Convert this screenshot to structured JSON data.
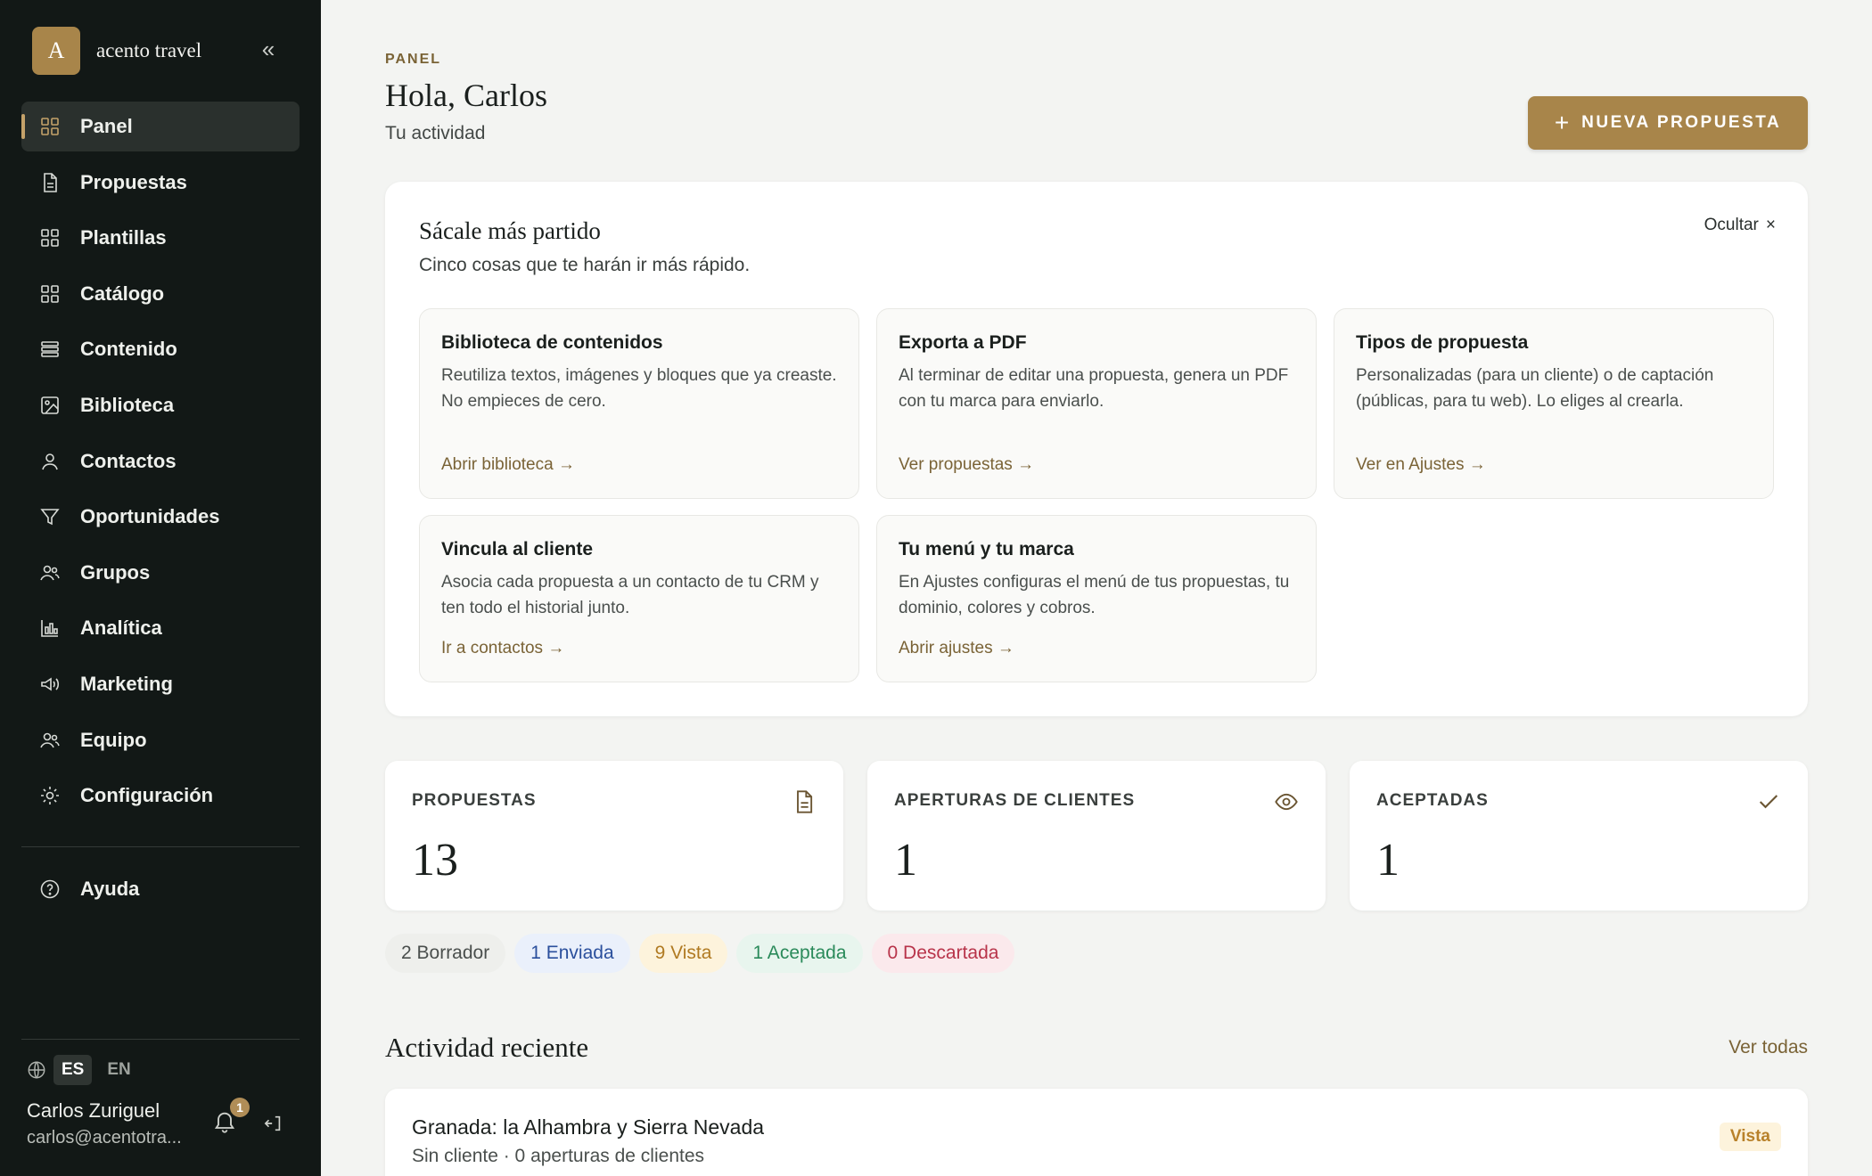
{
  "brand": {
    "initial": "A",
    "name": "acento travel",
    "collapse_icon": "double-chevron-left"
  },
  "nav": [
    {
      "label": "Panel",
      "icon": "dashboard-grid",
      "active": true
    },
    {
      "label": "Propuestas",
      "icon": "document"
    },
    {
      "label": "Plantillas",
      "icon": "grid"
    },
    {
      "label": "Catálogo",
      "icon": "grid"
    },
    {
      "label": "Contenido",
      "icon": "stack"
    },
    {
      "label": "Biblioteca",
      "icon": "image"
    },
    {
      "label": "Contactos",
      "icon": "user"
    },
    {
      "label": "Oportunidades",
      "icon": "filter"
    },
    {
      "label": "Grupos",
      "icon": "users"
    },
    {
      "label": "Analítica",
      "icon": "bar-chart"
    },
    {
      "label": "Marketing",
      "icon": "megaphone"
    },
    {
      "label": "Equipo",
      "icon": "users"
    },
    {
      "label": "Configuración",
      "icon": "sun-gear"
    }
  ],
  "help": {
    "label": "Ayuda",
    "icon": "question-circle"
  },
  "language": {
    "current": "ES",
    "other": "EN"
  },
  "user": {
    "name": "Carlos Zuriguel",
    "email": "carlos@acentotra...",
    "notifications": "1"
  },
  "header": {
    "eyebrow": "PANEL",
    "greeting": "Hola, Carlos",
    "subtitle": "Tu actividad",
    "new_button": "NUEVA PROPUESTA",
    "new_button_icon": "+"
  },
  "tips": {
    "title": "Sácale más partido",
    "subtitle": "Cinco cosas que te harán ir más rápido.",
    "hide_label": "Ocultar",
    "hide_icon": "×",
    "cards": [
      {
        "title": "Biblioteca de contenidos",
        "text": "Reutiliza textos, imágenes y bloques que ya creaste. No empieces de cero.",
        "link": "Abrir biblioteca →"
      },
      {
        "title": "Exporta a PDF",
        "text": "Al terminar de editar una propuesta, genera un PDF con tu marca para enviarlo.",
        "link": "Ver propuestas →"
      },
      {
        "title": "Tipos de propuesta",
        "text": "Personalizadas (para un cliente) o de captación (públicas, para tu web). Lo eliges al crearla.",
        "link": "Ver en Ajustes →"
      },
      {
        "title": "Vincula al cliente",
        "text": "Asocia cada propuesta a un contacto de tu CRM y ten todo el historial junto.",
        "link": "Ir a contactos →"
      },
      {
        "title": "Tu menú y tu marca",
        "text": "En Ajustes configuras el menú de tus propuestas, tu dominio, colores y cobros.",
        "link": "Abrir ajustes →"
      }
    ]
  },
  "stats": [
    {
      "label": "PROPUESTAS",
      "value": "13",
      "icon": "document-icon"
    },
    {
      "label": "APERTURAS DE CLIENTES",
      "value": "1",
      "icon": "eye-icon"
    },
    {
      "label": "ACEPTADAS",
      "value": "1",
      "icon": "check-icon"
    }
  ],
  "status_pills": [
    {
      "label": "2 Borrador",
      "color": "#4a4f4d",
      "bg": "#eeefec"
    },
    {
      "label": "1 Enviada",
      "color": "#2a4f9c",
      "bg": "#eaf0fb"
    },
    {
      "label": "9 Vista",
      "color": "#b07a22",
      "bg": "#fdf3dc"
    },
    {
      "label": "1 Aceptada",
      "color": "#2a8a5a",
      "bg": "#e8f5ee"
    },
    {
      "label": "0 Descartada",
      "color": "#b8344a",
      "bg": "#fbe9ec"
    }
  ],
  "activity": {
    "title": "Actividad reciente",
    "see_all": "Ver todas",
    "items": [
      {
        "title": "Granada: la Alhambra y Sierra Nevada",
        "subtitle": "Sin cliente · 0 aperturas de clientes",
        "status": "Vista"
      }
    ]
  },
  "colors": {
    "sidebar_bg": "#121816",
    "accent": "#a8854a",
    "page_bg": "#f3f4f2"
  }
}
